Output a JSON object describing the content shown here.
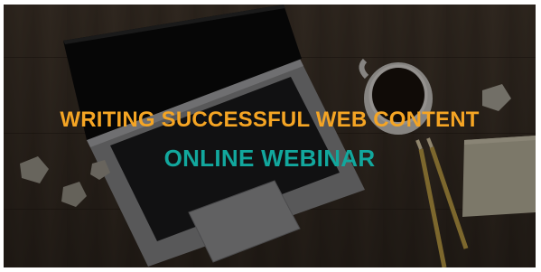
{
  "banner": {
    "headline": "WRITING SUCCESSFUL WEB CONTENT",
    "subheadline": "ONLINE WEBINAR"
  },
  "colors": {
    "headline": "#f5a524",
    "subheadline": "#12a79d",
    "background": "#5e4d3f"
  },
  "scene_objects": [
    "laptop",
    "coffee-cup",
    "sticky-notes",
    "pencils",
    "crumpled-paper"
  ]
}
